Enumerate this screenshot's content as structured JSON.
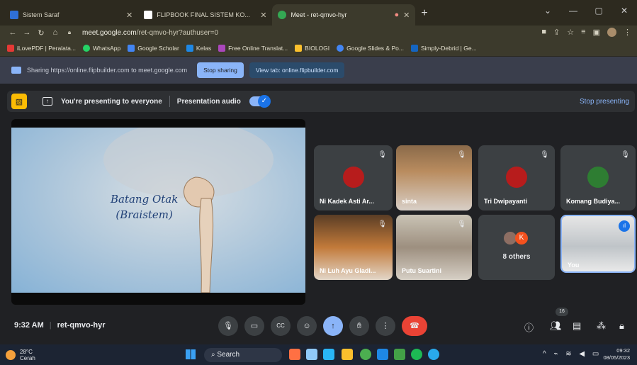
{
  "tabs": [
    {
      "title": "Sistem Saraf",
      "active": false
    },
    {
      "title": "FLIPBOOK FINAL SISTEM KO...",
      "active": false
    },
    {
      "title": "Meet - ret-qmvo-hyr",
      "active": true
    }
  ],
  "address": {
    "host": "meet.google.com",
    "path": "/ret-qmvo-hyr?authuser=0"
  },
  "bookmarks": [
    "iLovePDF | Peralata...",
    "WhatsApp",
    "Google Scholar",
    "Kelas",
    "Free Online Translat...",
    "BIOLOGI",
    "Google Slides & Po...",
    "Simply-Debrid | Ge..."
  ],
  "sharing": {
    "text": "Sharing https://online.flipbuilder.com to meet.google.com",
    "stop_label": "Stop sharing",
    "view_label": "View tab: online.flipbuilder.com"
  },
  "presenting": {
    "text": "You're presenting to everyone",
    "audio_label": "Presentation audio",
    "stop_label": "Stop presenting"
  },
  "slide": {
    "line1": "Batang Otak",
    "line2": "(Braistem)"
  },
  "participants": [
    {
      "name": "Ni Kadek Asti Ar...",
      "muted": true
    },
    {
      "name": "sinta",
      "muted": true
    },
    {
      "name": "Tri Dwipayanti",
      "muted": true
    },
    {
      "name": "Komang Budiya...",
      "muted": true
    },
    {
      "name": "Ni Luh Ayu Gladi...",
      "muted": true
    },
    {
      "name": "Putu Suartini",
      "muted": true
    },
    {
      "name": "8 others",
      "muted": false
    },
    {
      "name": "You",
      "muted": false
    }
  ],
  "others_avatar_letter": "K",
  "meeting": {
    "time": "9:32 AM",
    "code": "ret-qmvo-hyr",
    "participant_count": "16"
  },
  "taskbar": {
    "temp": "28°C",
    "weather": "Cerah",
    "search": "Search",
    "clock": "09:32",
    "date": "08/05/2023"
  }
}
